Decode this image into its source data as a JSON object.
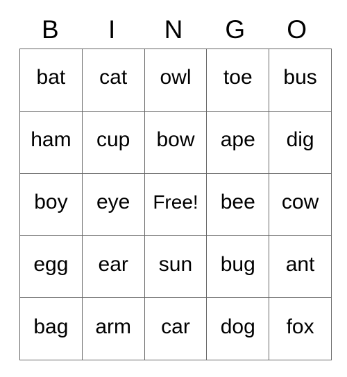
{
  "card": {
    "title": "BINGO",
    "header_letters": [
      "B",
      "I",
      "N",
      "G",
      "O"
    ],
    "free_space_label": "Free!",
    "grid_line_color": "#666666",
    "text_color": "#000000",
    "background_color": "#ffffff",
    "rows": [
      {
        "cells": [
          "bat",
          "cat",
          "owl",
          "toe",
          "bus"
        ]
      },
      {
        "cells": [
          "ham",
          "cup",
          "bow",
          "ape",
          "dig"
        ]
      },
      {
        "cells": [
          "boy",
          "eye",
          "Free!",
          "bee",
          "cow"
        ]
      },
      {
        "cells": [
          "egg",
          "ear",
          "sun",
          "bug",
          "ant"
        ]
      },
      {
        "cells": [
          "bag",
          "arm",
          "car",
          "dog",
          "fox"
        ]
      }
    ]
  }
}
